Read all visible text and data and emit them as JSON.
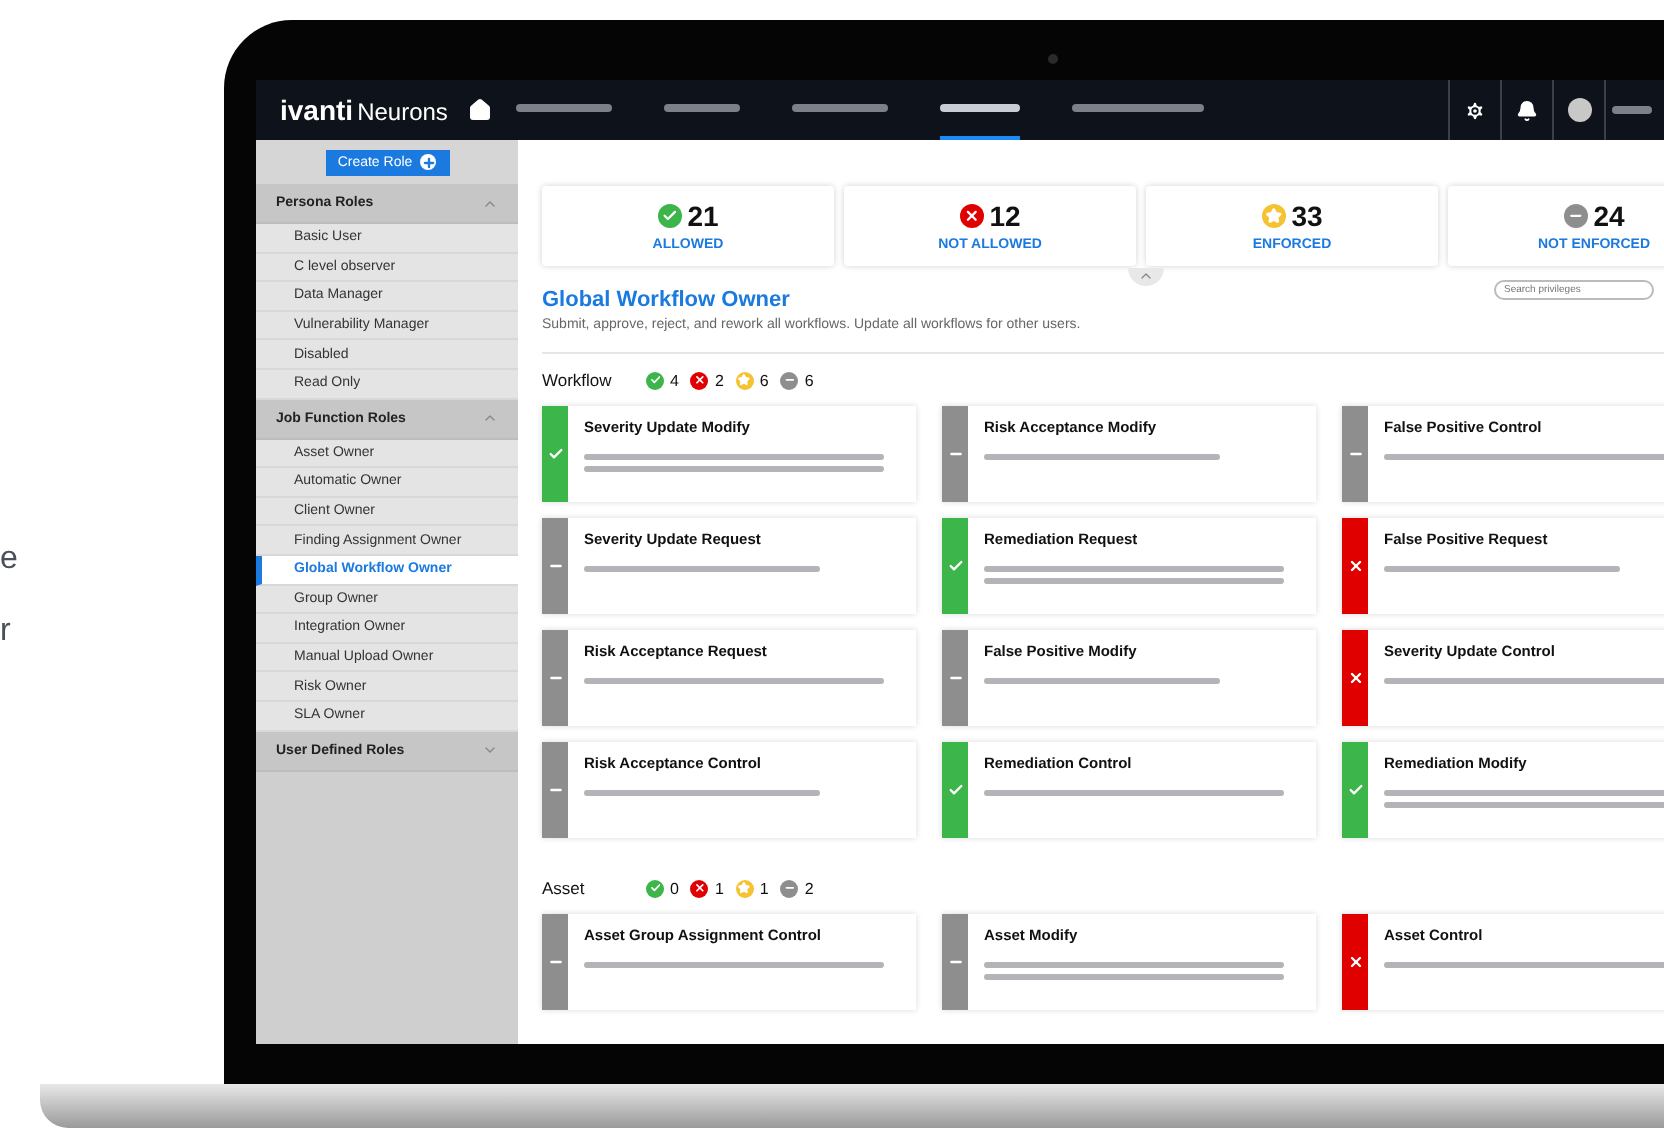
{
  "background_text": [
    "e",
    "r"
  ],
  "header": {
    "logo_brand": "ivanti",
    "logo_product": "Neurons",
    "nav_items": [
      {
        "selected": false
      },
      {
        "selected": false
      },
      {
        "selected": false
      },
      {
        "selected": true
      },
      {
        "selected": false
      }
    ]
  },
  "sidebar": {
    "create_button": "Create Role",
    "groups": [
      {
        "title": "Persona Roles",
        "expanded": true,
        "items": [
          {
            "label": "Basic User",
            "selected": false
          },
          {
            "label": "C level observer",
            "selected": false
          },
          {
            "label": "Data Manager",
            "selected": false
          },
          {
            "label": "Vulnerability Manager",
            "selected": false
          },
          {
            "label": "Disabled",
            "selected": false
          },
          {
            "label": "Read Only",
            "selected": false
          }
        ]
      },
      {
        "title": "Job Function Roles",
        "expanded": true,
        "items": [
          {
            "label": "Asset Owner",
            "selected": false
          },
          {
            "label": "Automatic Owner",
            "selected": false
          },
          {
            "label": "Client Owner",
            "selected": false
          },
          {
            "label": "Finding Assignment Owner",
            "selected": false
          },
          {
            "label": "Global Workflow Owner",
            "selected": true
          },
          {
            "label": "Group Owner",
            "selected": false
          },
          {
            "label": "Integration Owner",
            "selected": false
          },
          {
            "label": "Manual Upload Owner",
            "selected": false
          },
          {
            "label": "Risk Owner",
            "selected": false
          },
          {
            "label": "SLA Owner",
            "selected": false
          }
        ]
      },
      {
        "title": "User Defined Roles",
        "expanded": false
      }
    ]
  },
  "stats": [
    {
      "kind": "allowed",
      "count": "21",
      "label": "ALLOWED"
    },
    {
      "kind": "not_allowed",
      "count": "12",
      "label": "NOT ALLOWED"
    },
    {
      "kind": "enforced",
      "count": "33",
      "label": "ENFORCED"
    },
    {
      "kind": "not_enforced",
      "count": "24",
      "label": "NOT ENFORCED"
    }
  ],
  "summary_expanded": true,
  "role": {
    "title": "Global Workflow Owner",
    "description": "Submit, approve, reject, and rework all workflows. Update all workflows for other users.",
    "search": {
      "placeholder": "Search privileges"
    }
  },
  "sections": [
    {
      "title": "Workflow",
      "counts": [
        {
          "kind": "allowed",
          "count": "4"
        },
        {
          "kind": "not_allowed",
          "count": "2"
        },
        {
          "kind": "enforced",
          "count": "6"
        },
        {
          "kind": "not_enforced",
          "count": "6"
        }
      ],
      "privileges": [
        {
          "title": "Severity Update Modify",
          "kind": "allowed"
        },
        {
          "title": "Risk Acceptance Modify",
          "kind": "not_enforced"
        },
        {
          "title": "False Positive Control",
          "kind": "not_enforced"
        },
        {
          "title": "Severity Update Request",
          "kind": "not_enforced"
        },
        {
          "title": "Remediation Request",
          "kind": "allowed"
        },
        {
          "title": "False Positive Request",
          "kind": "not_allowed"
        },
        {
          "title": "Risk Acceptance Request",
          "kind": "not_enforced"
        },
        {
          "title": "False Positive Modify",
          "kind": "not_enforced"
        },
        {
          "title": "Severity Update Control",
          "kind": "not_allowed"
        },
        {
          "title": "Risk Acceptance Control",
          "kind": "not_enforced"
        },
        {
          "title": "Remediation Control",
          "kind": "allowed"
        },
        {
          "title": "Remediation Modify",
          "kind": "allowed"
        }
      ]
    },
    {
      "title": "Asset",
      "counts": [
        {
          "kind": "allowed",
          "count": "0"
        },
        {
          "kind": "not_allowed",
          "count": "1"
        },
        {
          "kind": "enforced",
          "count": "1"
        },
        {
          "kind": "not_enforced",
          "count": "2"
        }
      ],
      "privileges": [
        {
          "title": "Asset Group Assignment Control",
          "kind": "not_enforced"
        },
        {
          "title": "Asset Modify",
          "kind": "not_enforced"
        },
        {
          "title": "Asset Control",
          "kind": "not_allowed"
        }
      ]
    }
  ]
}
